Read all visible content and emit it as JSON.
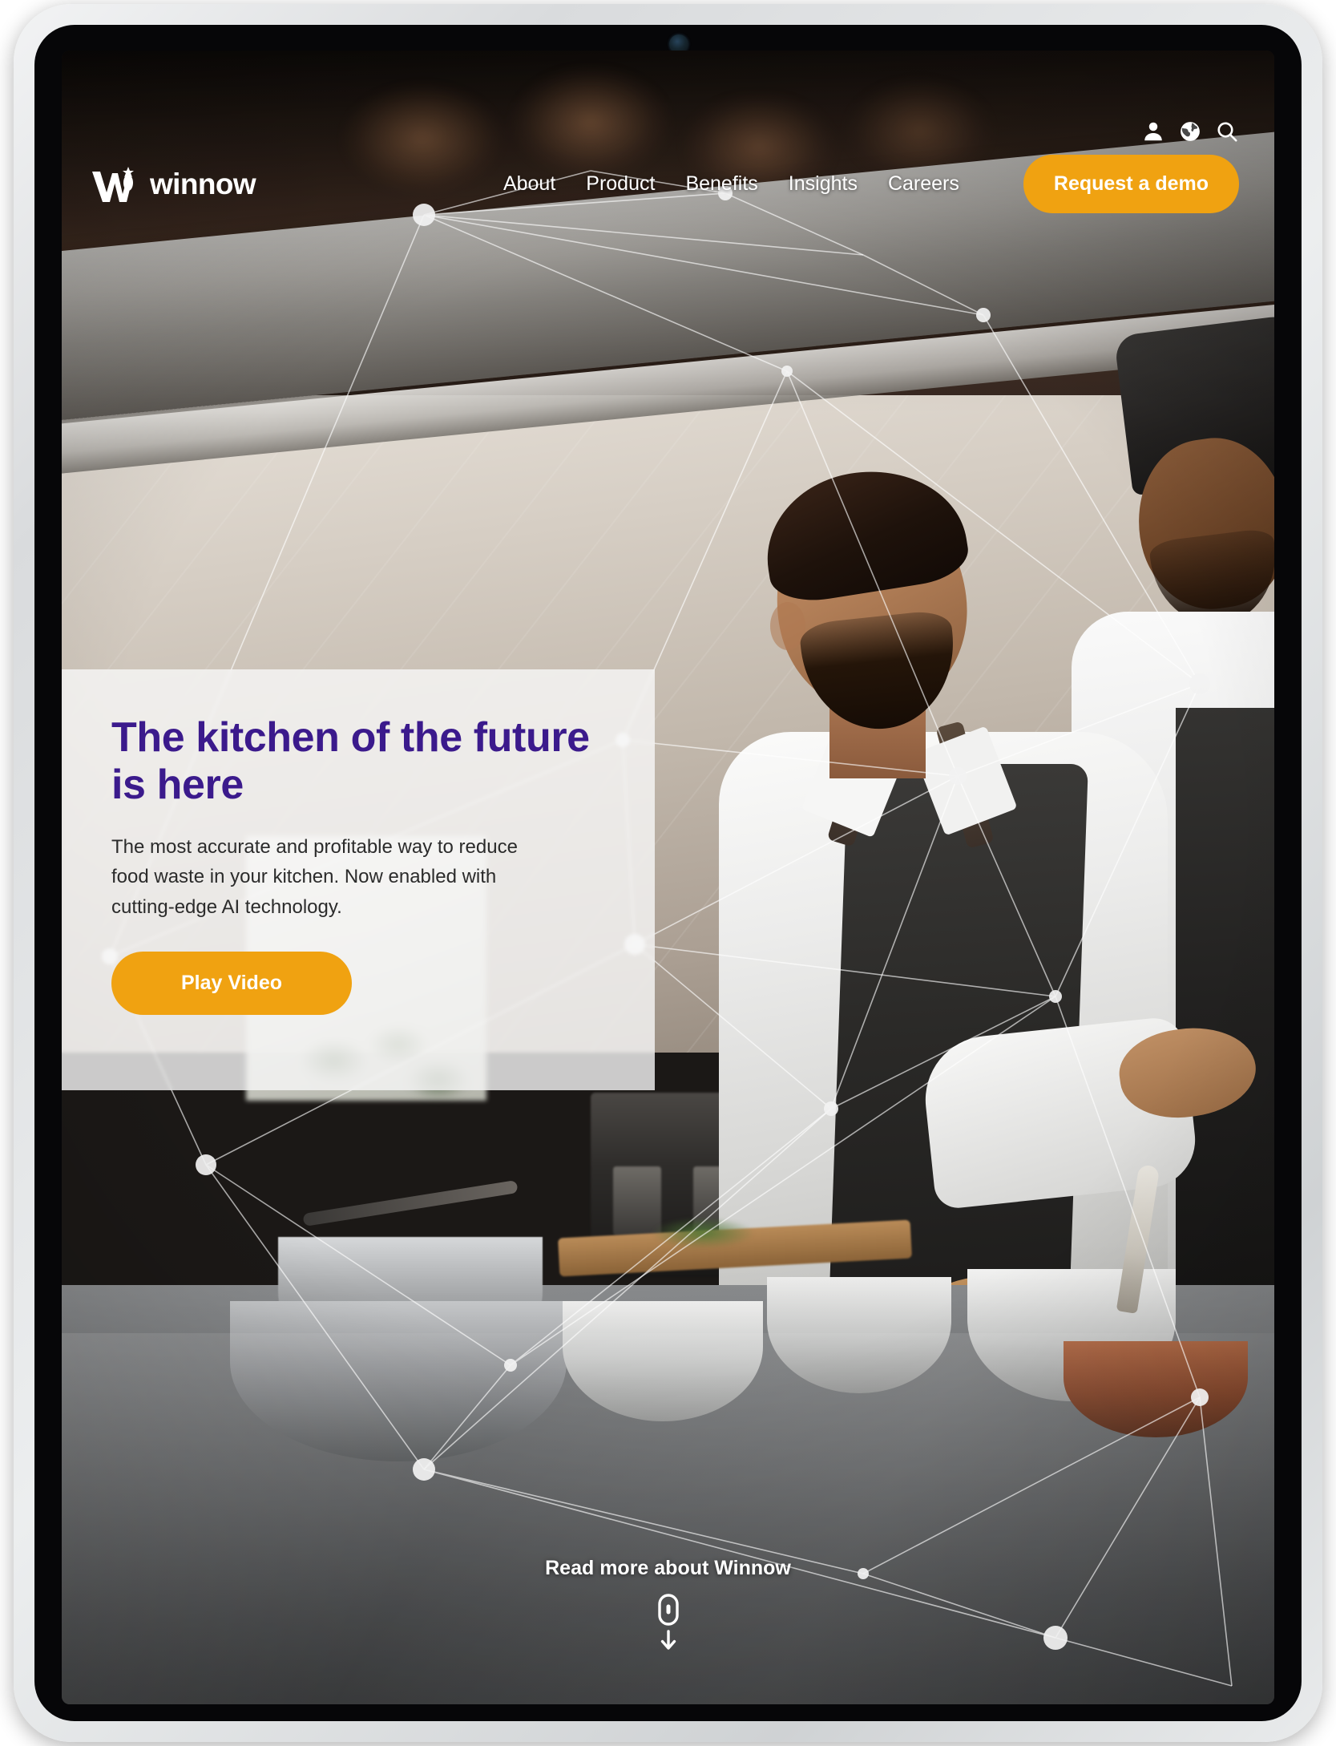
{
  "device": {
    "kind": "tablet",
    "camera_label": "front-camera"
  },
  "site": {
    "brand": "winnow",
    "brand_logo_icon": "winnow-w-carrot-logo"
  },
  "utility_bar": {
    "items": [
      {
        "icon": "user-account-icon",
        "label": "Account"
      },
      {
        "icon": "globe-language-icon",
        "label": "Language"
      },
      {
        "icon": "search-icon",
        "label": "Search"
      }
    ]
  },
  "nav": {
    "links": [
      {
        "label": "About"
      },
      {
        "label": "Product"
      },
      {
        "label": "Benefits"
      },
      {
        "label": "Insights"
      },
      {
        "label": "Careers"
      }
    ],
    "cta": {
      "label": "Request a demo"
    }
  },
  "hero": {
    "title": "The kitchen of the future\nis here",
    "subtitle": "The most accurate and profitable way to reduce food waste in your kitchen. Now enabled with cutting-edge AI technology.",
    "button": {
      "label": "Play Video",
      "icon": "play-icon"
    }
  },
  "scroll_prompt": {
    "label": "Read more about Winnow",
    "icon": "mouse-scroll-down-icon"
  },
  "colors": {
    "accent_orange": "#f0a211",
    "heading_purple": "#3b1a8c",
    "nav_text": "#ffffff",
    "hero_card_bg": "rgba(247,247,247,0.80)",
    "body_text": "#2b2b2b"
  }
}
